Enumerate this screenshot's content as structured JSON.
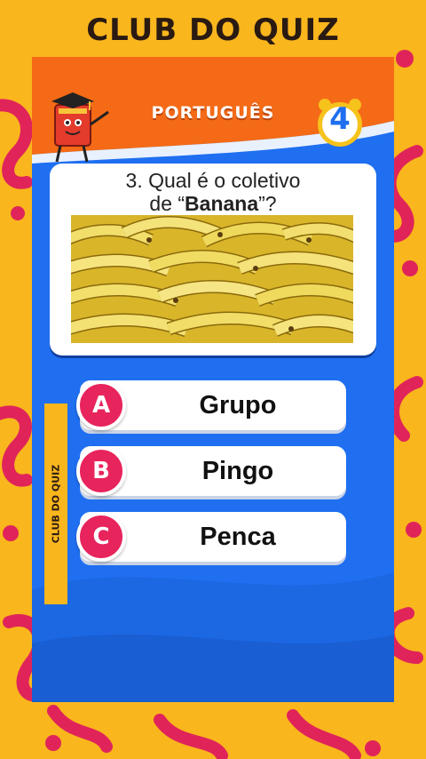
{
  "brand": {
    "title": "CLUB DO QUIZ",
    "side_label": "CLUB DO QUIZ"
  },
  "header": {
    "subject": "PORTUGUÊS",
    "timer": "4"
  },
  "question": {
    "number_prefix": "3. Qual é o coletivo",
    "line2_pre": "de “",
    "keyword": "Banana",
    "line2_post": "”?"
  },
  "options": [
    {
      "letter": "A",
      "text": "Grupo"
    },
    {
      "letter": "B",
      "text": "Pingo"
    },
    {
      "letter": "C",
      "text": "Penca"
    }
  ],
  "colors": {
    "background": "#f9b61d",
    "card_blue": "#1f6ff0",
    "header_orange": "#f46a16",
    "option_badge": "#e8245c",
    "squiggle": "#e0245a"
  },
  "icons": {
    "mascot": "book-mascot-icon",
    "timer": "alarm-clock-icon",
    "photo": "bananas-image"
  }
}
